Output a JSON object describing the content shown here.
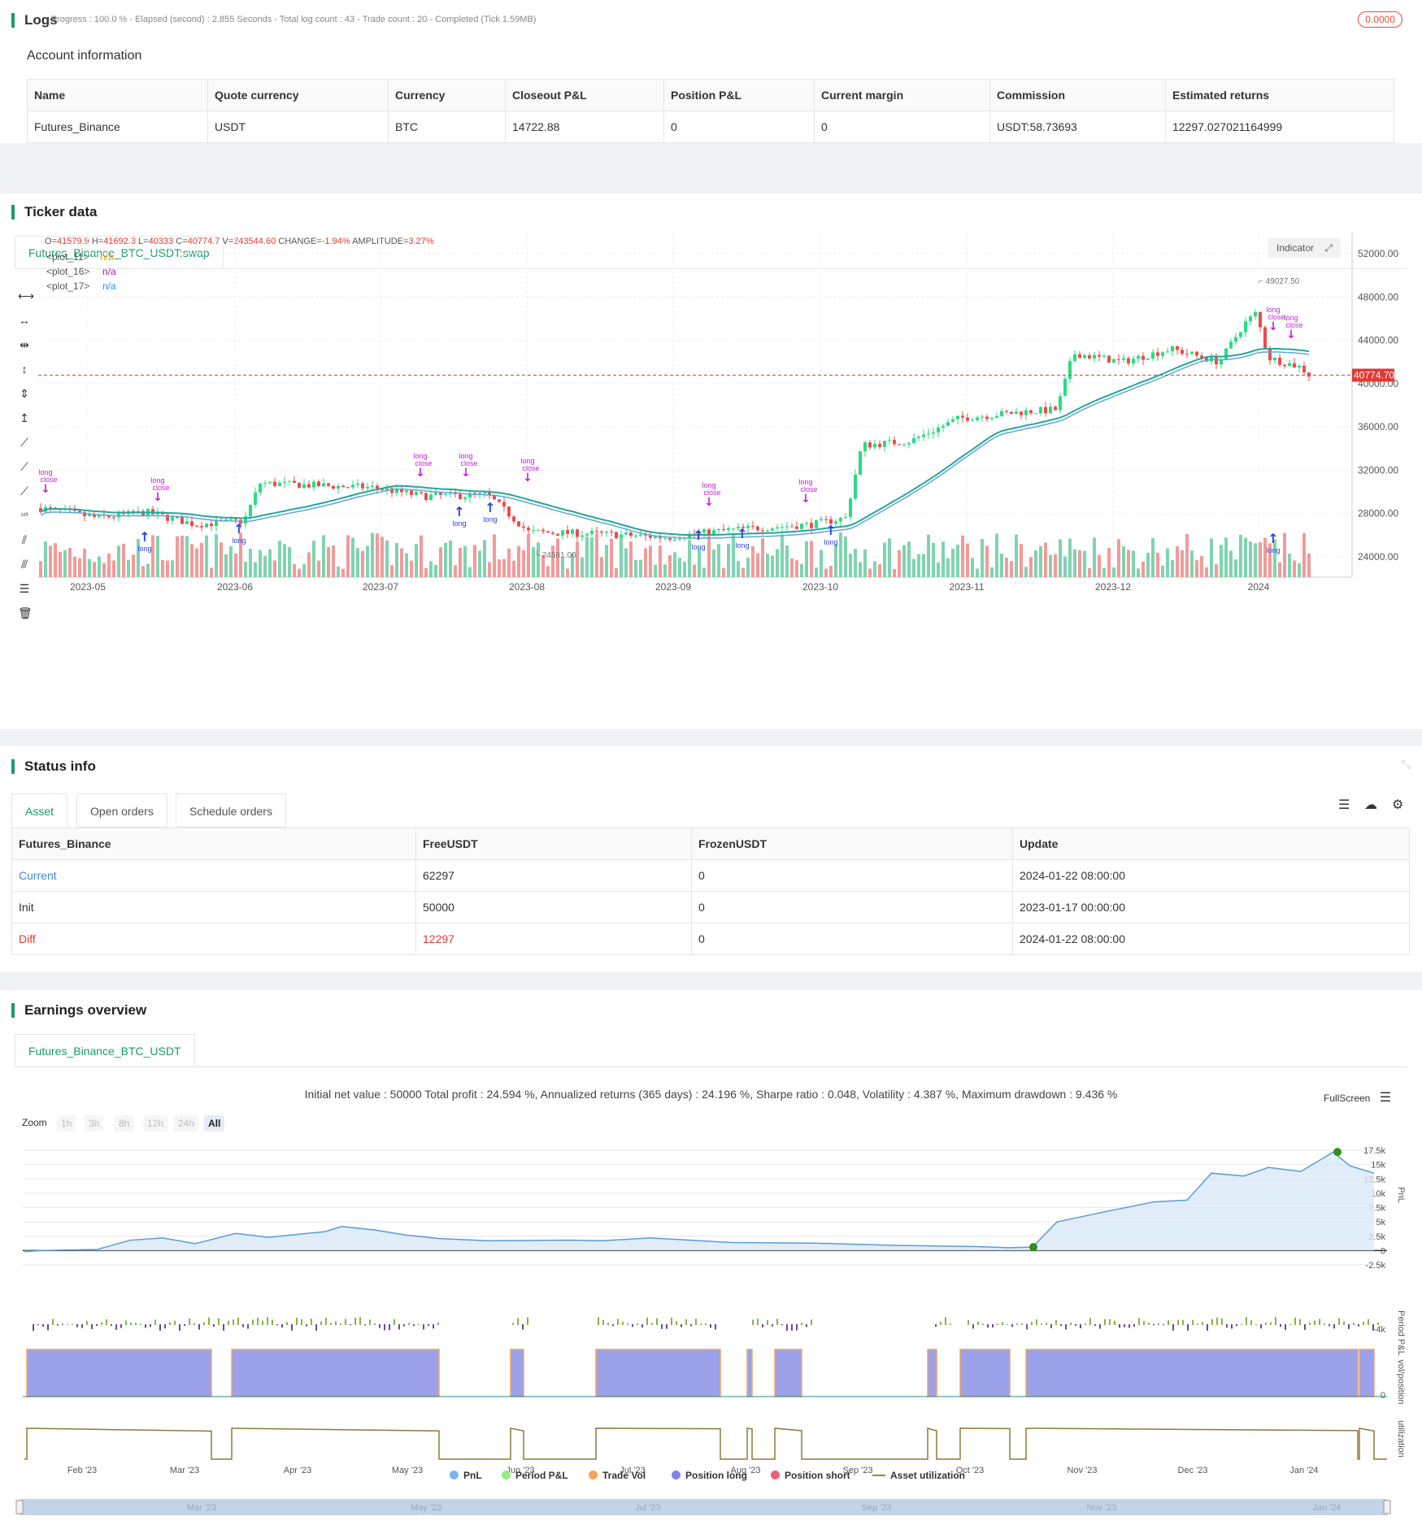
{
  "logs": {
    "title": "Logs",
    "summary": "- Progress : 100.0 % - Elapsed (second) : 2.855  Seconds - Total log count : 43 - Trade count : 20 - Completed (Tick 1.59MB)",
    "badge": "0.0000"
  },
  "account": {
    "title": "Account information",
    "headers": [
      "Name",
      "Quote currency",
      "Currency",
      "Closeout P&L",
      "Position P&L",
      "Current margin",
      "Commission",
      "Estimated returns"
    ],
    "row": [
      "Futures_Binance",
      "USDT",
      "BTC",
      "14722.88",
      "0",
      "0",
      "USDT:58.73693",
      "12297.027021164999"
    ]
  },
  "ticker": {
    "title": "Ticker data",
    "tab": "Futures_Binance_BTC_USDT:swap",
    "ohlc": {
      "o_label": "O=",
      "o": "41579.9",
      "h_label": "H=",
      "h": "41692.3",
      "l_label": "L=",
      "l": "40333",
      "c_label": "C=",
      "c": "40774.7",
      "v_label": "V=",
      "v": "243544.60",
      "change_label": "CHANGE=",
      "change": "-1.94%",
      "amp_label": "AMPLITUDE=",
      "amp": "3.27%"
    },
    "plots": [
      {
        "name": "<plot_11>",
        "value": "n/a",
        "color": "#f0a000"
      },
      {
        "name": "<plot_16>",
        "value": "n/a",
        "color": "#9c27b0"
      },
      {
        "name": "<plot_17>",
        "value": "n/a",
        "color": "#2196f3"
      }
    ],
    "indicator_btn": "Indicator",
    "price_ticks": [
      "52000.00",
      "48000.00",
      "44000.00",
      "40000.00",
      "36000.00",
      "32000.00",
      "28000.00",
      "24000.00"
    ],
    "date_ticks": [
      "2023-05",
      "2023-06",
      "2023-07",
      "2023-08",
      "2023-09",
      "2023-10",
      "2023-11",
      "2023-12",
      "2024"
    ],
    "high_label": "49027.50",
    "low_label": "24581.00",
    "last_price": "40774.70",
    "label_long": "long",
    "label_close": "close",
    "label_one": "1",
    "colors": {
      "up": "#26de81",
      "down": "#eb4d4b",
      "ma": "#26a69a",
      "ma2": "#5fa8d3"
    }
  },
  "status": {
    "title": "Status info",
    "tabs": [
      "Asset",
      "Open orders",
      "Schedule orders"
    ],
    "headers": [
      "Futures_Binance",
      "FreeUSDT",
      "FrozenUSDT",
      "Update"
    ],
    "rows": [
      [
        "Current",
        "62297",
        "0",
        "2024-01-22 08:00:00"
      ],
      [
        "Init",
        "50000",
        "0",
        "2023-01-17 00:00:00"
      ],
      [
        "Diff",
        "12297",
        "0",
        "2024-01-22 08:00:00"
      ]
    ]
  },
  "earnings": {
    "title": "Earnings overview",
    "tab": "Futures_Binance_BTC_USDT",
    "summary": "Initial net value : 50000 Total profit : 24.594 %, Annualized returns (365 days) : 24.196 %, Sharpe ratio : 0.048, Volatility : 4.387 %, Maximum drawdown : 9.436 %",
    "fullscreen": "FullScreen",
    "zoom_label": "Zoom",
    "zoom_buttons": [
      "1h",
      "3h",
      "8h",
      "12h",
      "24h",
      "All"
    ],
    "pnl_ticks": [
      "17.5k",
      "15k",
      "12.5k",
      "10k",
      "7.5k",
      "5k",
      "2.5k",
      "0",
      "-2.5k"
    ],
    "period_tick": "-4k",
    "pos_tick": "0",
    "axis_titles": [
      "PnL",
      "Period P&L",
      "vol/position",
      "utilization"
    ],
    "month_ticks": [
      "Feb '23",
      "Mar '23",
      "Apr '23",
      "May '23",
      "Jun '23",
      "Jul '23",
      "Aug '23",
      "Sep '23",
      "Oct '23",
      "Nov '23",
      "Dec '23",
      "Jan '24"
    ],
    "nav_ticks": [
      "Mar '23",
      "May '23",
      "Jul '23",
      "Sep '23",
      "Nov '23",
      "Jan '24"
    ],
    "legend": [
      {
        "label": "PnL",
        "color": "#7cb5ec"
      },
      {
        "label": "Period P&L",
        "color": "#90ed7d"
      },
      {
        "label": "Trade Vol",
        "color": "#f7a35c"
      },
      {
        "label": "Position long",
        "color": "#8085e9"
      },
      {
        "label": "Position short",
        "color": "#f15c80"
      },
      {
        "label": "Asset utilization",
        "color": "#8d8d3a"
      }
    ]
  }
}
